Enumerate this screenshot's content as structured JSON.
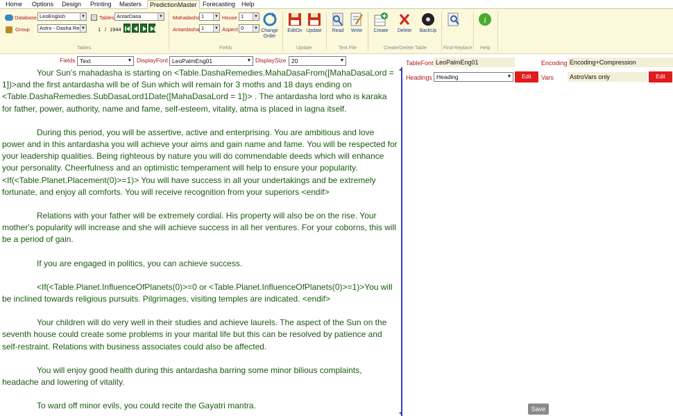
{
  "menu": {
    "items": [
      "Home",
      "Options",
      "Design",
      "Printing",
      "Masters",
      "PredictionMaster",
      "Forecasting",
      "Help"
    ]
  },
  "ribbon": {
    "database_label": "Database",
    "database_value": "LeoEnglish",
    "group_label": "Group",
    "group_value": "Astro - Dasha Reac",
    "tables_label": "Tables",
    "tables_value": "AntarDasa",
    "record_pos": "1",
    "record_sep": "/",
    "record_total": "1944",
    "mahadasha_label": "Mahadasha",
    "mahadasha_value": "1",
    "house_label": "House",
    "house_value": "1",
    "antardasha_label": "Antardasha",
    "antardasha_value": "1",
    "aspect_label": "Aspect",
    "aspect_value": "0",
    "change_order": "Change Order",
    "edit_on": "EditOn",
    "update": "Update",
    "read": "Read",
    "write": "Write",
    "create": "Create",
    "delete": "Delete",
    "backup": "BackUp",
    "find_replace": "Find-Replace",
    "help": "Help",
    "groups": {
      "tables": "Tables",
      "fields": "Fields",
      "update": "Update",
      "textfile": "Text File",
      "createdelete": "Create/Delete Table",
      "findreplace": "Find-Replace",
      "help": "Help"
    }
  },
  "fieldsbar": {
    "fields_label": "Fields",
    "fields_value": "Text",
    "displayfont_label": "DisplayFont",
    "displayfont_value": "LeoPalmEng01",
    "displaysize_label": "DisplaySize",
    "displaysize_value": "20"
  },
  "editor": {
    "paragraphs": [
      "Your Sun's mahadasha is starting on <Table.DashaRemedies.MahaDasaFrom([MahaDasaLord = 1])>and the first antardasha will be of Sun which will remain for 3 moths and 18 days ending on <Table.DashaRemedies.SubDasaLord1Date([MahaDasaLord = 1])> . The antardasha lord who is karaka for father, power, authority, name and fame, self-esteem, vitality, atma is placed in lagna itself.",
      "During this period, you will be assertive, active and enterprising. You are ambitious and love power and in this antardasha you will achieve your aims and gain name and fame. You will be respected for your leadership qualities. Being righteous by nature you will do commendable deeds which will enhance your personality. Cheerfulness and an optimistic temperament will help to ensure your popularity. <If(<Table.Planet.Placement(0)>=1)> You will have success in all your undertakings and be extremely fortunate, and enjoy all comforts. You will receive recognition from your superiors <endif>",
      "Relations with your father will be extremely cordial. His property will also be on the rise. Your mother's popularity will increase and she will achieve success in all her ventures. For your coborns, this will be a period of gain.",
      "If you are engaged in politics, you can achieve success.",
      "<If(<Table.Planet.InfluenceOfPlanets(0)>=0 or <Table.Planet.InfluenceOfPlanets(0)>=1)>You will be inclined towards religious pursuits. Pilgrimages, visiting temples are indicated. <endif>",
      "Your children will do very well in their studies and achieve laurels. The aspect of the Sun on the seventh house could create some problems in your marital life but this can be resolved by patience and self-restraint. Relations with business associates could also be affected.",
      "You will enjoy good health during this antardasha barring some minor bilious complaints, headache and lowering of vitality.",
      "To ward off minor evils, you could recite the Gayatri mantra."
    ]
  },
  "right": {
    "tablefont_label": "TableFont",
    "tablefont_value": "LeoPalmEng01",
    "encoding_label": "Encoding",
    "encoding_value": "Encoding+Compression",
    "headings_label": "Headings",
    "headings_value": "Heading",
    "vars_label": "Vars",
    "vars_value": "AstroVars only",
    "edit1": "Edit",
    "edit2": "Edit",
    "save": "Save"
  },
  "colors": {
    "ribbon_bg": "#fbf8dc",
    "label_red": "#b01818",
    "editor_text": "#1a5a10",
    "edit_button": "#e21b1b",
    "splitter": "#2b3fc4"
  }
}
